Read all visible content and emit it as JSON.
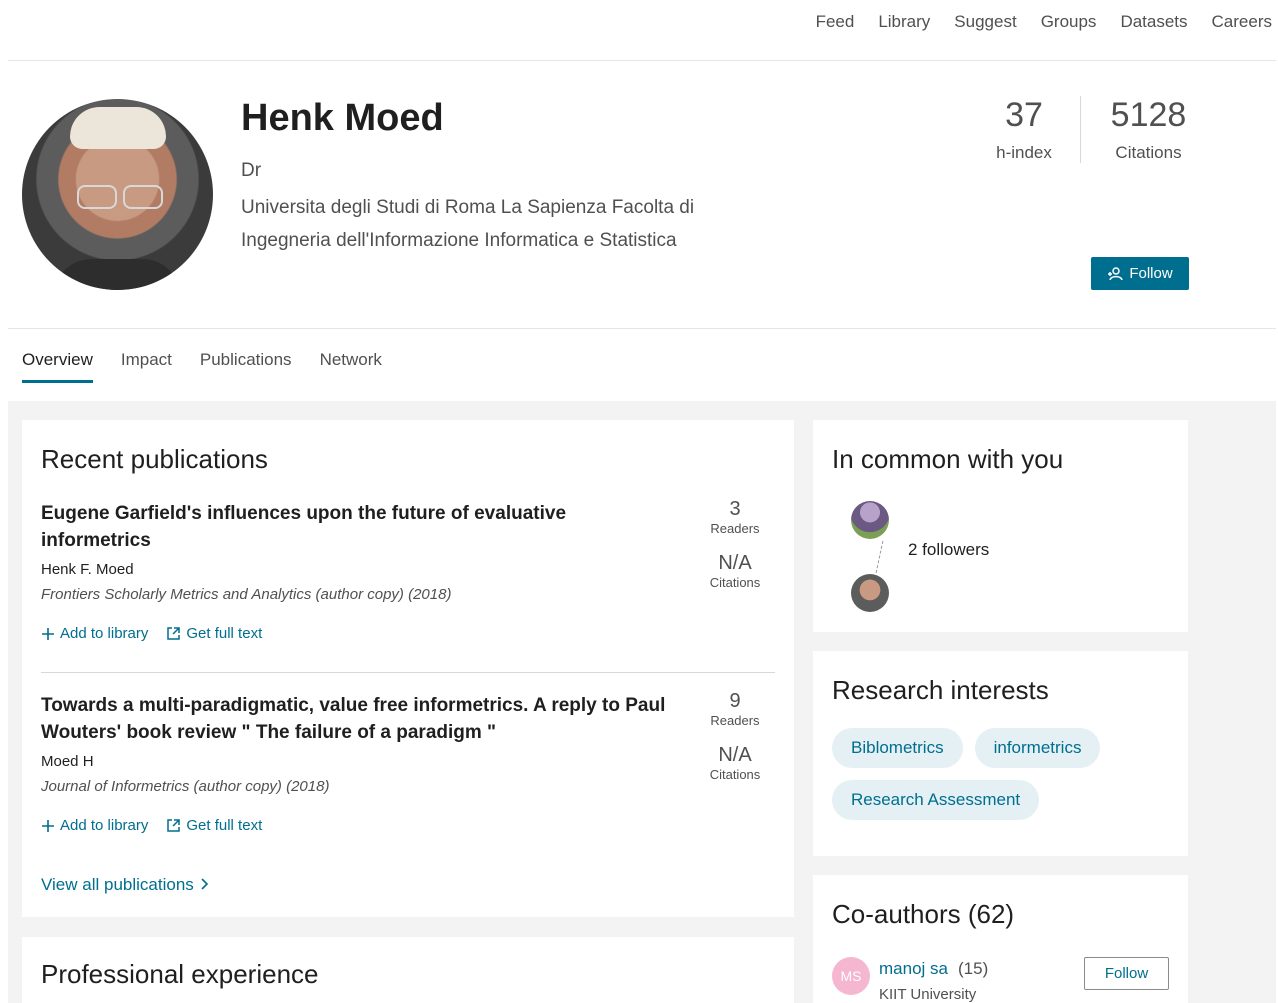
{
  "nav": {
    "items": [
      "Feed",
      "Library",
      "Suggest",
      "Groups",
      "Datasets",
      "Careers"
    ]
  },
  "profile": {
    "name": "Henk Moed",
    "degree": "Dr",
    "affiliation_line1": "Universita degli Studi di Roma La Sapienza Facolta di",
    "affiliation_line2": "Ingegneria dell'Informazione Informatica e Statistica",
    "stats": [
      {
        "value": "37",
        "label": "h-index"
      },
      {
        "value": "5128",
        "label": "Citations"
      }
    ],
    "follow_label": "Follow",
    "follow_icon": "add-person-icon"
  },
  "tabs": [
    {
      "label": "Overview",
      "active": true
    },
    {
      "label": "Impact",
      "active": false
    },
    {
      "label": "Publications",
      "active": false
    },
    {
      "label": "Network",
      "active": false
    }
  ],
  "recent_publications": {
    "title": "Recent publications",
    "items": [
      {
        "title": "Eugene Garfield's influences upon the future of evaluative informetrics",
        "authors": "Henk F. Moed",
        "journal": "Frontiers Scholarly Metrics and Analytics (author copy) (2018)",
        "readers_value": "3",
        "readers_label": "Readers",
        "citations_value": "N/A",
        "citations_label": "Citations",
        "add_label": "Add to library",
        "fulltext_label": "Get full text"
      },
      {
        "title": "Towards a multi-paradigmatic, value free informetrics. A reply to Paul Wouters' book review \" The failure of a paradigm \"",
        "authors": "Moed H",
        "journal": "Journal of Informetrics (author copy) (2018)",
        "readers_value": "9",
        "readers_label": "Readers",
        "citations_value": "N/A",
        "citations_label": "Citations",
        "add_label": "Add to library",
        "fulltext_label": "Get full text"
      }
    ],
    "view_all": "View all publications"
  },
  "professional_experience": {
    "title": "Professional experience"
  },
  "in_common": {
    "title": "In common with you",
    "followers": "2 followers"
  },
  "research_interests": {
    "title": "Research interests",
    "tags": [
      "Biblometrics",
      "informetrics",
      "Research Assessment"
    ]
  },
  "coauthors": {
    "title": "Co-authors (62)",
    "items": [
      {
        "initials": "MS",
        "name": "manoj sa",
        "count": "(15)",
        "institution": "KIIT University",
        "follow_label": "Follow"
      }
    ]
  },
  "colors": {
    "accent": "#006e8f",
    "tag_bg": "#e5f0f4",
    "page_bg": "#f3f3f3"
  }
}
